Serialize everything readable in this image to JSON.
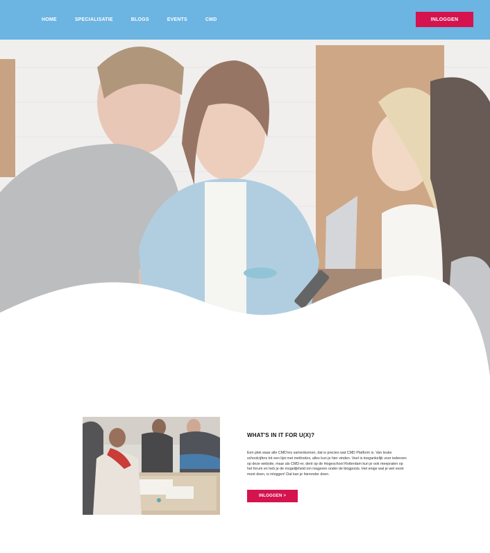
{
  "nav": {
    "items": [
      {
        "label": "HOME"
      },
      {
        "label": "SPECIALISATIE"
      },
      {
        "label": "BLOGS"
      },
      {
        "label": "EVENTS"
      },
      {
        "label": "CMD"
      }
    ],
    "login_label": "INLOGGEN"
  },
  "feature": {
    "title": "WHAT'S IN IT FOR U(X)?",
    "text": "Een plek waar alle CMD'ers samenkomen, dat is precies wat CMD Platform is. Van leuke schoolcijfers tot een lijst met methodes, alles kun je hier vinden. Veel is toegankelijk voor iedereen op deze website, maar als CMD-er, dent op de Hogeschool Rotterdam kun je ook meepraten op het forum en heb je de mogelijkheid om reageren onder de blogposts. Het enige wat je wel eerst moet doen, is inloggen! Dat kan je hieronder doen.",
    "button_label": "INLOGGEN >"
  },
  "colors": {
    "nav_bg": "#6cb4e2",
    "accent": "#d4134f"
  }
}
